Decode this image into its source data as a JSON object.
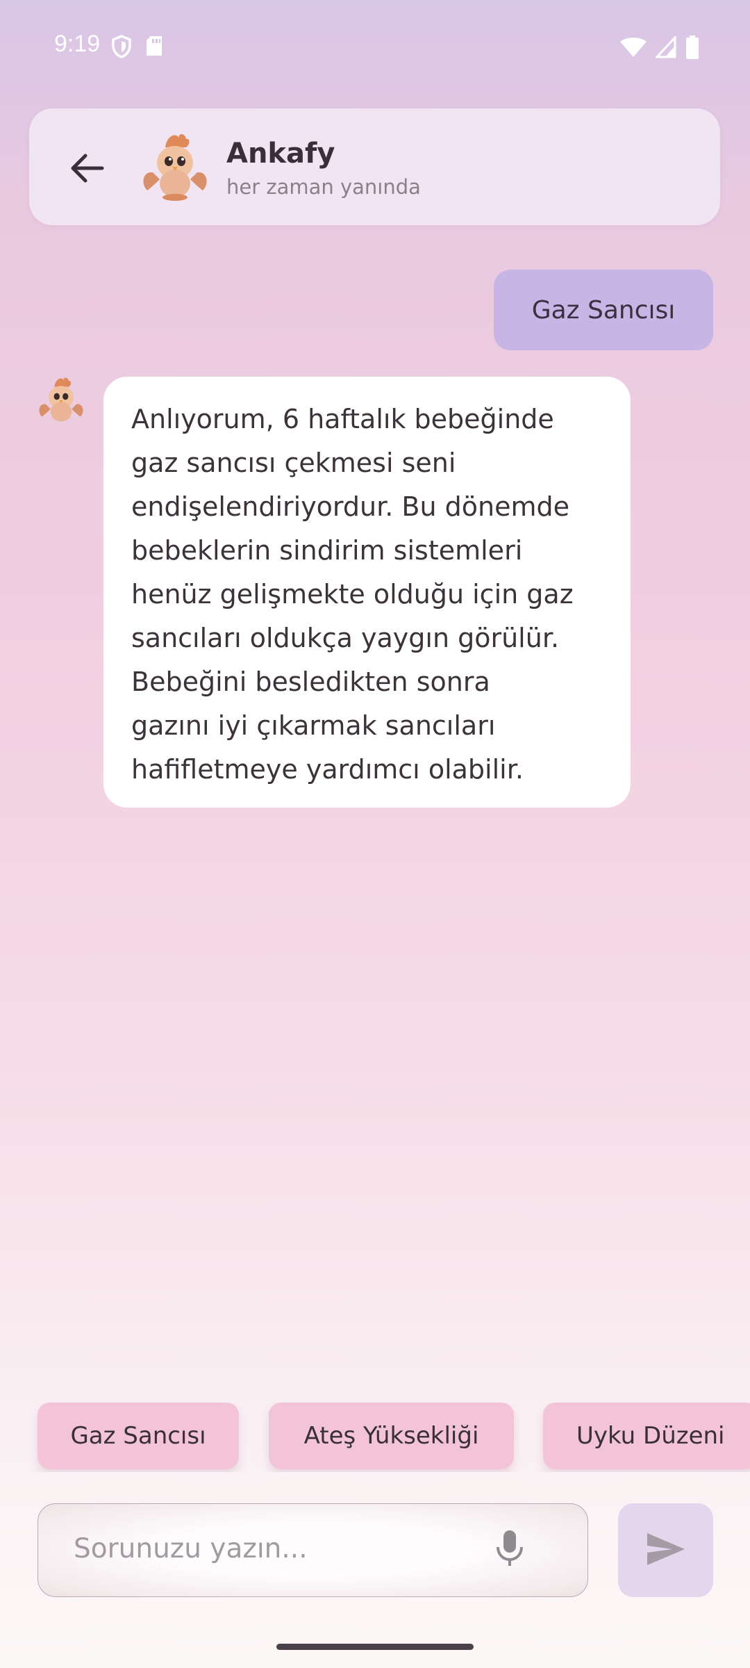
{
  "status_bar": {
    "time": "9:19",
    "left_icons": [
      "shield-icon",
      "sd-card-icon"
    ],
    "right_icons": [
      "wifi-icon",
      "signal-icon",
      "battery-icon"
    ]
  },
  "header": {
    "title": "Ankafy",
    "subtitle": "her zaman yanında",
    "back_icon": "arrow-left-icon",
    "avatar_icon": "phoenix-chick-mascot"
  },
  "messages": [
    {
      "sender": "user",
      "text": "Gaz Sancısı"
    },
    {
      "sender": "bot",
      "lines": [
        "Anlıyorum, 6 haftalık bebeğinde",
        "gaz sancısı çekmesi seni",
        "endişelendiriyordur. Bu dönemde",
        "bebeklerin sindirim sistemleri",
        "henüz gelişmekte olduğu için gaz",
        "sancıları oldukça yaygın görülür.",
        "Bebeğini besledikten sonra",
        "gazını iyi çıkarmak sancıları",
        "hafifletmeye yardımcı olabilir."
      ]
    }
  ],
  "quick_replies": [
    "Gaz Sancısı",
    "Ateş Yüksekliği",
    "Uyku Düzeni"
  ],
  "composer": {
    "placeholder": "Sorunuzu yazın...",
    "mic_icon": "microphone-icon",
    "send_icon": "send-icon"
  },
  "colors": {
    "user_bubble": "#c7b5e6",
    "chip": "#f3c4d8",
    "send_button": "#e4d6ec"
  }
}
